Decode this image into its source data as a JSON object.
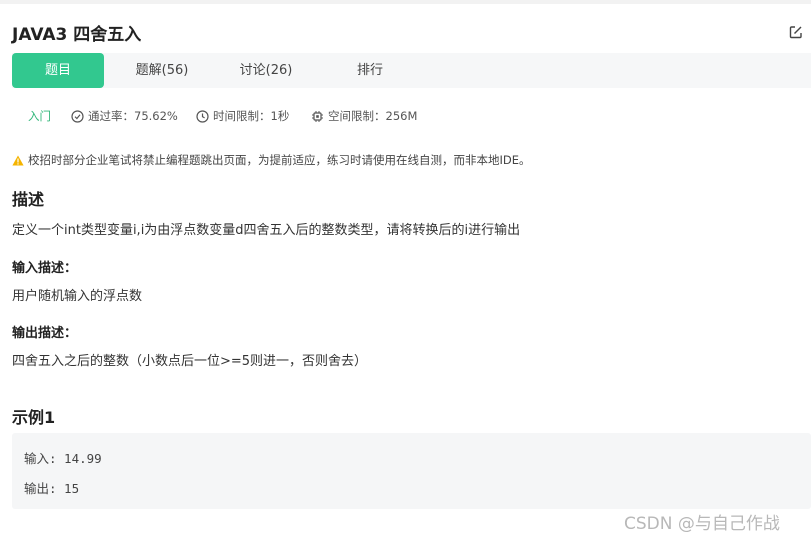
{
  "problem": {
    "title": "JAVA3  四舍五入"
  },
  "tabs": [
    {
      "label": "题目",
      "active": true
    },
    {
      "label": "题解(56)",
      "active": false
    },
    {
      "label": "讨论(26)",
      "active": false
    },
    {
      "label": "排行",
      "active": false
    }
  ],
  "meta": {
    "difficulty": "入门",
    "pass_rate": "通过率：75.62%",
    "time_limit": "时间限制：1秒",
    "memory_limit": "空间限制：256M"
  },
  "notice": "校招时部分企业笔试将禁止编程题跳出页面，为提前适应，练习时请使用在线自测，而非本地IDE。",
  "description": {
    "heading": "描述",
    "text": "定义一个int类型变量i,i为由浮点数变量d四舍五入后的整数类型，请将转换后的i进行输出"
  },
  "input_desc": {
    "heading": "输入描述：",
    "text": "用户随机输入的浮点数"
  },
  "output_desc": {
    "heading": "输出描述：",
    "text": "四舍五入之后的整数（小数点后一位>=5则进一，否则舍去）"
  },
  "example": {
    "heading": "示例1",
    "input_line": "输入: 14.99",
    "output_line": "输出: 15"
  },
  "watermark": "CSDN @与自己作战",
  "icons": {
    "edit": "edit-icon",
    "pass_rate": "check-circle-icon",
    "time": "clock-icon",
    "memory": "chip-icon",
    "warning": "warning-icon"
  },
  "colors": {
    "accent": "#32c88f",
    "difficulty": "#32b77a",
    "warning": "#f5b400"
  }
}
